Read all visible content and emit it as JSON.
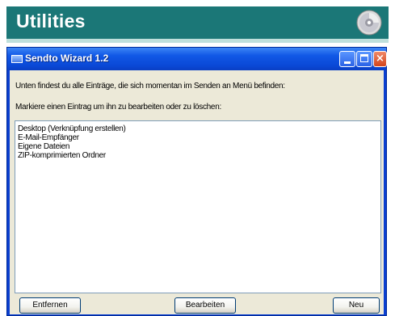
{
  "banner": {
    "title": "Utilities",
    "icon": "cd-icon",
    "color": "#1b7777"
  },
  "window": {
    "title": "Sendto Wizard 1.2",
    "controls": {
      "minimize": "minimize-icon",
      "maximize": "maximize-icon",
      "close": "×"
    },
    "info_line_1": "Unten findest du alle Einträge, die sich momentan im Senden an Menü befinden:",
    "info_line_2": "Markiere einen Eintrag um ihn zu bearbeiten oder zu löschen:",
    "list_items": [
      "Desktop (Verknüpfung erstellen)",
      "E-Mail-Empfänger",
      "Eigene Dateien",
      "ZIP-komprimierten Ordner"
    ],
    "buttons": {
      "remove": "Entfernen",
      "edit": "Bearbeiten",
      "new": "Neu"
    }
  },
  "colors": {
    "titlebar": "#0a48d6",
    "client": "#ece9d8",
    "close": "#d2441c"
  }
}
